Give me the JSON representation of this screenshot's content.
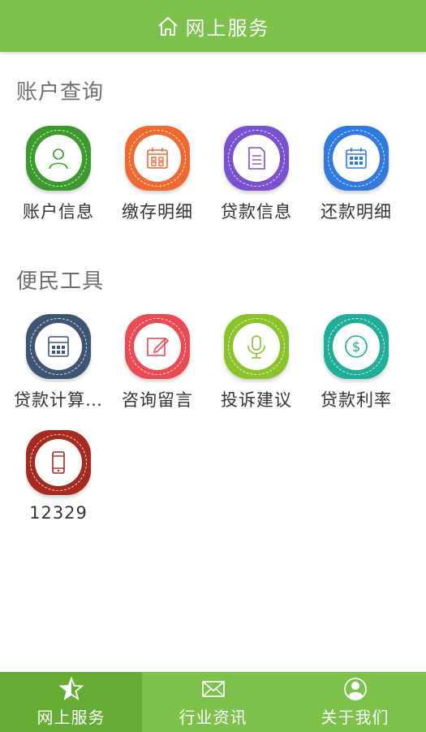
{
  "header": {
    "title": "网上服务",
    "icon": "home-icon"
  },
  "sections": [
    {
      "title": "账户查询"
    },
    {
      "title": "便民工具"
    }
  ],
  "account_items": [
    {
      "label": "账户信息",
      "icon": "user-icon",
      "color": "#3a9a2a"
    },
    {
      "label": "缴存明细",
      "icon": "calendar-icon",
      "color": "#f06a30"
    },
    {
      "label": "贷款信息",
      "icon": "document-icon",
      "color": "#7a4fd0"
    },
    {
      "label": "还款明细",
      "icon": "calendar-grid-icon",
      "color": "#2f7ae0"
    }
  ],
  "tool_items": [
    {
      "label": "贷款计算…",
      "icon": "calculator-icon",
      "color": "#3e5573"
    },
    {
      "label": "咨询留言",
      "icon": "edit-icon",
      "color": "#ec4a52"
    },
    {
      "label": "投诉建议",
      "icon": "microphone-icon",
      "color": "#8ac22a"
    },
    {
      "label": "贷款利率",
      "icon": "dollar-icon",
      "color": "#1fae9a"
    },
    {
      "label": "12329",
      "icon": "phone-icon",
      "color": "#a52a20"
    }
  ],
  "tabs": [
    {
      "label": "网上服务",
      "icon": "star-icon",
      "active": true
    },
    {
      "label": "行业资讯",
      "icon": "mail-icon",
      "active": false
    },
    {
      "label": "关于我们",
      "icon": "person-icon",
      "active": false
    }
  ],
  "colors": {
    "brand": "#7cc14a",
    "brand_active": "#66ad35"
  }
}
